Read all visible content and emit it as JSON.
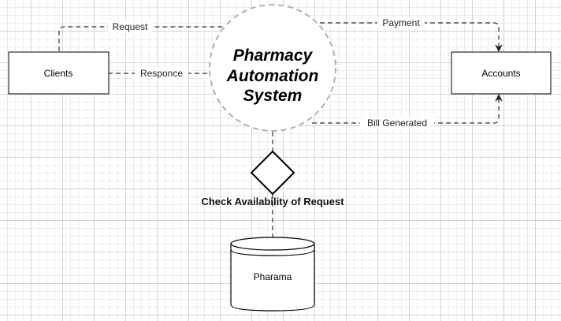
{
  "diagram": {
    "center_title": [
      "Pharmacy",
      "Automation",
      "System"
    ],
    "nodes": {
      "clients": "Clients",
      "accounts": "Accounts",
      "database": "Pharama"
    },
    "decision_label": "Check Availability of Request",
    "edges": {
      "request": "Request",
      "response": "Responce",
      "payment": "Payment",
      "bill": "Bill Generated"
    }
  },
  "colors": {
    "line": "#333333",
    "circle_stroke": "#b0b0b0",
    "grid": "#d4d4d4",
    "background": "#ffffff"
  }
}
